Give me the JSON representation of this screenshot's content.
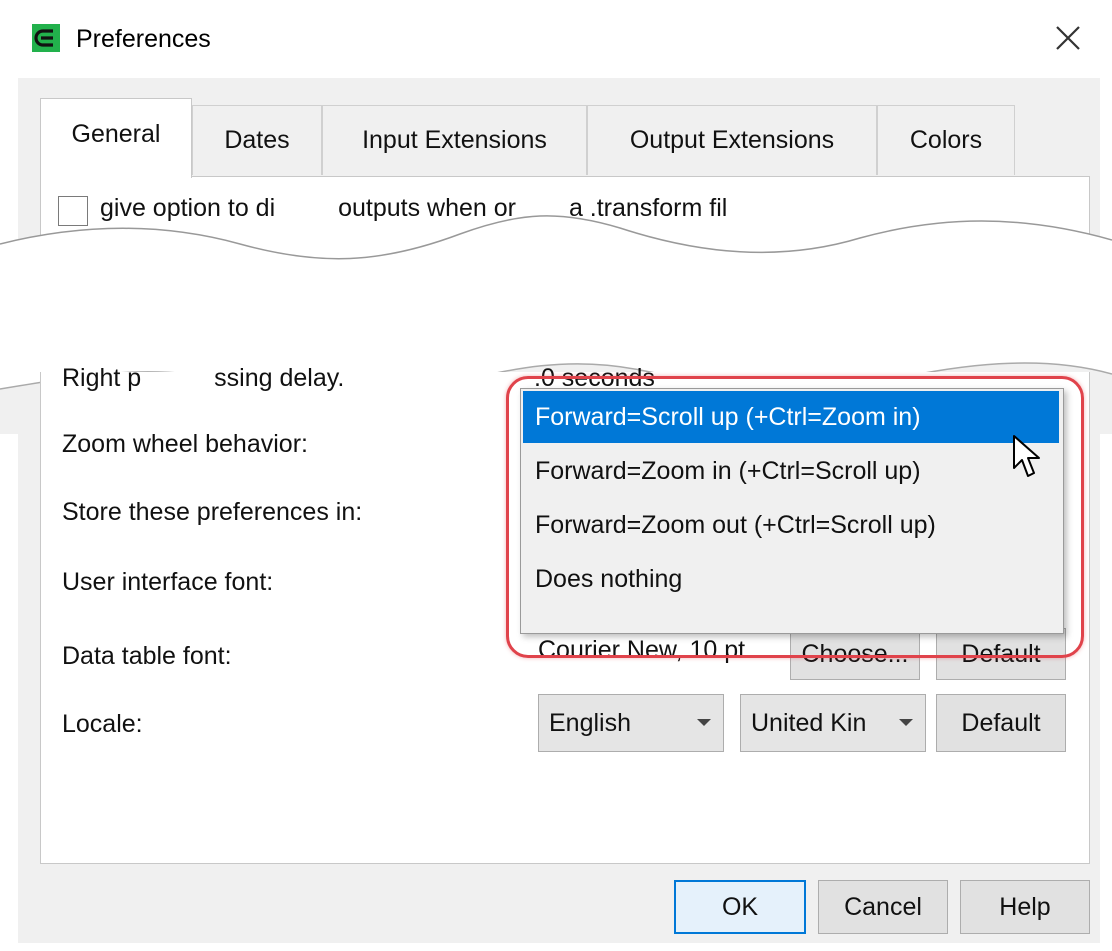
{
  "window": {
    "title": "Preferences"
  },
  "tabs": [
    {
      "label": "General",
      "active": true
    },
    {
      "label": "Dates",
      "active": false
    },
    {
      "label": "Input Extensions",
      "active": false
    },
    {
      "label": "Output Extensions",
      "active": false
    },
    {
      "label": "Colors",
      "active": false
    }
  ],
  "general": {
    "partial_option": "give option to disable outputs when opening a .transform file",
    "partial_option_visible": "give option to di",
    "partial_option_visible_2": "outputs when or",
    "partial_option_visible_3": "a .transform fil",
    "right_press_label": "Right p",
    "right_press_label_2": "ssing delay.",
    "right_press_value": ".0 seconds",
    "zoom_label": "Zoom wheel behavior:",
    "store_label": "Store these preferences in:",
    "ui_font_label": "User interface font:",
    "data_font_label": "Data table font:",
    "data_font_value": "Courier New, 10 pt",
    "choose_label": "Choose...",
    "default_label": "Default",
    "locale_label": "Locale:",
    "locale_language": "English",
    "locale_country": "United Kin",
    "locale_default": "Default"
  },
  "zoom_dropdown": {
    "options": [
      "Forward=Scroll up (+Ctrl=Zoom in)",
      "Forward=Zoom in (+Ctrl=Scroll up)",
      "Forward=Zoom out (+Ctrl=Scroll up)",
      "Does nothing"
    ],
    "selected_index": 0
  },
  "buttons": {
    "ok": "OK",
    "cancel": "Cancel",
    "help": "Help"
  },
  "colors": {
    "accent": "#0078d7",
    "highlight_ring": "#e0434b",
    "app_icon": "#22b14c"
  },
  "icons": {
    "app": "easy-data-transform-icon",
    "close": "close-icon",
    "cursor": "mouse-pointer-icon"
  }
}
